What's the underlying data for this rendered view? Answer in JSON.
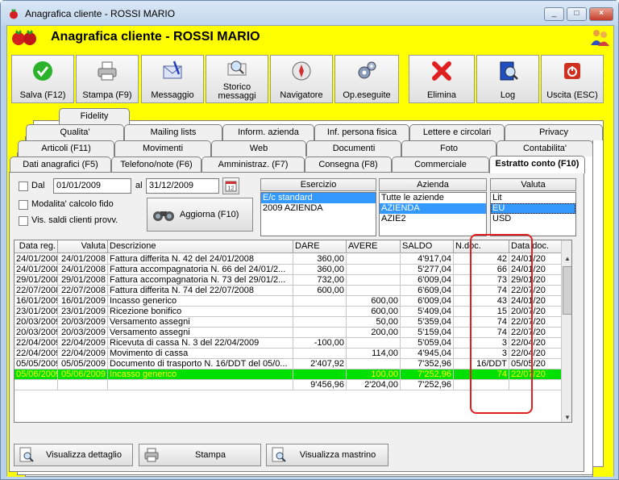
{
  "window": {
    "title": "Anagrafica cliente - ROSSI MARIO",
    "minimize": "_",
    "maximize": "□",
    "close": "×"
  },
  "header": {
    "title": "Anagrafica cliente - ROSSI MARIO"
  },
  "toolbar": [
    {
      "label": "Salva (F12)",
      "icon": "check-icon"
    },
    {
      "label": "Stampa (F9)",
      "icon": "printer-icon"
    },
    {
      "label": "Messaggio",
      "icon": "message-icon"
    },
    {
      "label": "Storico messaggi",
      "icon": "message-history-icon"
    },
    {
      "label": "Navigatore",
      "icon": "compass-icon"
    },
    {
      "label": "Op.eseguite",
      "icon": "gears-icon"
    },
    {
      "label": "Elimina",
      "icon": "delete-x-icon"
    },
    {
      "label": "Log",
      "icon": "log-book-icon"
    },
    {
      "label": "Uscita (ESC)",
      "icon": "exit-power-icon"
    }
  ],
  "tabs": {
    "row1": [
      "Fidelity"
    ],
    "row2": [
      "Qualita'",
      "Mailing lists",
      "Inform. azienda",
      "Inf. persona fisica",
      "Lettere e circolari",
      "Privacy"
    ],
    "row3": [
      "Articoli (F11)",
      "Movimenti",
      "Web",
      "Documenti",
      "Foto",
      "Contabilita'"
    ],
    "row4": [
      "Dati anagrafici (F5)",
      "Telefono/note (F6)",
      "Amministraz. (F7)",
      "Consegna (F8)",
      "Commerciale",
      "Estratto conto (F10)"
    ]
  },
  "filters": {
    "dal_label": "Dal",
    "dal_value": "01/01/2009",
    "al_label": "al",
    "al_value": "31/12/2009",
    "modalita_label": "Modalita' calcolo fido",
    "vis_saldi_label": "Vis. saldi clienti provv.",
    "aggiorna_label": "Aggiorna (F10)"
  },
  "lists": {
    "esercizio": {
      "header": "Esercizio",
      "items": [
        "E/c standard",
        "2009 AZIENDA"
      ],
      "selected": 0
    },
    "azienda": {
      "header": "Azienda",
      "items": [
        "Tutte le aziende",
        "AZIENDA",
        "AZIE2"
      ],
      "selected": 1
    },
    "valuta": {
      "header": "Valuta",
      "items": [
        "Lit",
        "EU",
        "USD"
      ],
      "selected": 1
    }
  },
  "grid": {
    "columns": [
      "Data reg.",
      "Valuta",
      "Descrizione",
      "DARE",
      "AVERE",
      "SALDO",
      "N.doc.",
      "Data doc."
    ],
    "rows": [
      [
        "24/01/2008",
        "24/01/2008",
        "Fattura differita N. 42 del 24/01/2008",
        "360,00",
        "",
        "4'917,04",
        "42",
        "24/01/20"
      ],
      [
        "24/01/2008",
        "24/01/2008",
        "Fattura accompagnatoria N. 66 del 24/01/2...",
        "360,00",
        "",
        "5'277,04",
        "66",
        "24/01/20"
      ],
      [
        "29/01/2008",
        "29/01/2008",
        "Fattura accompagnatoria N. 73 del 29/01/2...",
        "732,00",
        "",
        "6'009,04",
        "73",
        "29/01/20"
      ],
      [
        "22/07/2008",
        "22/07/2008",
        "Fattura differita N. 74 del 22/07/2008",
        "600,00",
        "",
        "6'609,04",
        "74",
        "22/07/20"
      ],
      [
        "16/01/2009",
        "16/01/2009",
        "Incasso generico",
        "",
        "600,00",
        "6'009,04",
        "43",
        "24/01/20"
      ],
      [
        "23/01/2009",
        "23/01/2009",
        "Ricezione bonifico",
        "",
        "600,00",
        "5'409,04",
        "15",
        "20/07/20"
      ],
      [
        "20/03/2009",
        "20/03/2009",
        "Versamento assegni",
        "",
        "50,00",
        "5'359,04",
        "74",
        "22/07/20"
      ],
      [
        "20/03/2009",
        "20/03/2009",
        "Versamento assegni",
        "",
        "200,00",
        "5'159,04",
        "74",
        "22/07/20"
      ],
      [
        "22/04/2009",
        "22/04/2009",
        "Ricevuta di cassa N. 3 del 22/04/2009",
        "-100,00",
        "",
        "5'059,04",
        "3",
        "22/04/20"
      ],
      [
        "22/04/2009",
        "22/04/2009",
        "Movimento di cassa",
        "",
        "114,00",
        "4'945,04",
        "3",
        "22/04/20"
      ],
      [
        "05/05/2009",
        "05/05/2009",
        "Documento di trasporto N. 16/DDT del 05/0...",
        "2'407,92",
        "",
        "7'352,96",
        "16/DDT",
        "05/05/20"
      ],
      [
        "05/06/2009",
        "05/06/2009",
        "Incasso generico",
        "",
        "100,00",
        "7'252,96",
        "74",
        "22/07/20"
      ]
    ],
    "selected_row": 11,
    "totals": [
      "",
      "",
      "",
      "9'456,96",
      "2'204,00",
      "7'252,96",
      "",
      ""
    ]
  },
  "footer": [
    {
      "label": "Visualizza dettaglio",
      "icon": "magnifier-doc-icon"
    },
    {
      "label": "Stampa",
      "icon": "printer-icon"
    },
    {
      "label": "Visualizza mastrino",
      "icon": "magnifier-doc-icon"
    }
  ]
}
